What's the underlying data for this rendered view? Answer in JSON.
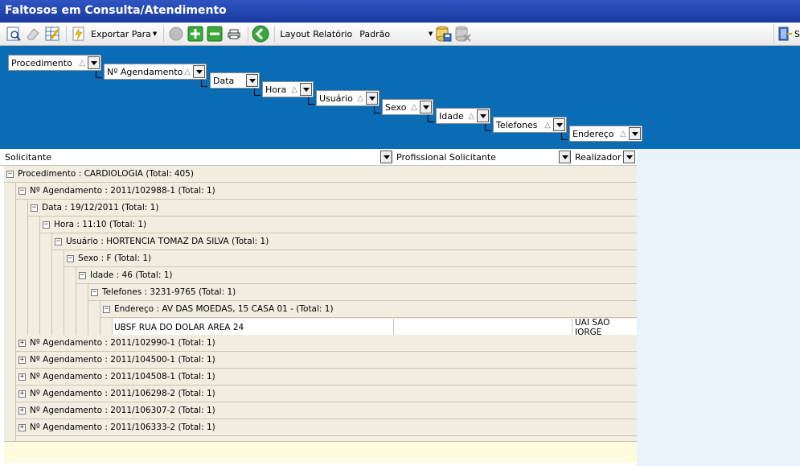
{
  "window": {
    "title": "Faltosos em Consulta/Atendimento"
  },
  "toolbar": {
    "export_label": "Exportar Para",
    "layout_label": "Layout Relatório",
    "layout_value": "Padrão",
    "right_label": "S"
  },
  "group_panel": {
    "chips": [
      {
        "label": "Procedimento"
      },
      {
        "label": "Nº Agendamento"
      },
      {
        "label": "Data"
      },
      {
        "label": "Hora"
      },
      {
        "label": "Usuário"
      },
      {
        "label": "Sexo"
      },
      {
        "label": "Idade"
      },
      {
        "label": "Telefones"
      },
      {
        "label": "Endereço"
      }
    ],
    "sort_glyph": "△"
  },
  "columns": {
    "solicitante": "Solicitante",
    "profissional": "Profissional Solicitante",
    "realizador": "Realizador"
  },
  "grid": {
    "expanded": [
      {
        "text": "Procedimento : CARDIOLOGIA (Total: 405)",
        "toggle": "−"
      },
      {
        "text": "Nº Agendamento : 2011/102988-1 (Total: 1)",
        "toggle": "−"
      },
      {
        "text": "Data : 19/12/2011 (Total: 1)",
        "toggle": "−"
      },
      {
        "text": "Hora : 11:10 (Total: 1)",
        "toggle": "−"
      },
      {
        "text": "Usuário : HORTENCIA TOMAZ DA SILVA (Total: 1)",
        "toggle": "−"
      },
      {
        "text": "Sexo : F (Total: 1)",
        "toggle": "−"
      },
      {
        "text": "Idade : 46 (Total: 1)",
        "toggle": "−"
      },
      {
        "text": "Telefones : 3231-9765 (Total: 1)",
        "toggle": "−"
      },
      {
        "text": "Endereço : AV  DAS MOEDAS, 15 CASA 01 -  (Total: 1)",
        "toggle": "−"
      }
    ],
    "data_row": {
      "solicitante": "UBSF RUA DO DOLAR AREA 24",
      "profissional": "",
      "realizador": "UAI SAO JORGE"
    },
    "collapsed": [
      {
        "text": "Nº Agendamento : 2011/102990-1 (Total: 1)",
        "toggle": "+"
      },
      {
        "text": "Nº Agendamento : 2011/104500-1 (Total: 1)",
        "toggle": "+"
      },
      {
        "text": "Nº Agendamento : 2011/104508-1 (Total: 1)",
        "toggle": "+"
      },
      {
        "text": "Nº Agendamento : 2011/106298-2 (Total: 1)",
        "toggle": "+"
      },
      {
        "text": "Nº Agendamento : 2011/106307-2 (Total: 1)",
        "toggle": "+"
      },
      {
        "text": "Nº Agendamento : 2011/106333-2 (Total: 1)",
        "toggle": "+"
      }
    ]
  }
}
